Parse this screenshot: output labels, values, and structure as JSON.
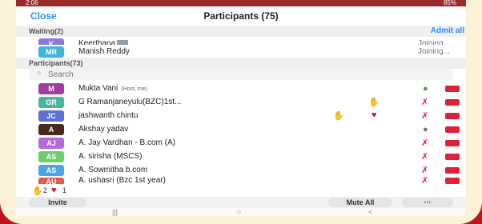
{
  "status_bar": {
    "time": "2:06",
    "battery": "85%"
  },
  "header": {
    "close_label": "Close",
    "title": "Participants (75)"
  },
  "waiting": {
    "label": "Waiting(2)",
    "admit_all_label": "Admit all",
    "items": [
      {
        "initials": "K",
        "name": "Keerthana",
        "status": "Joining...",
        "color": "#8b7bd8"
      },
      {
        "initials": "MR",
        "name": "Manish Reddy",
        "status": "Joining...",
        "color": "#3fb6d8"
      }
    ]
  },
  "participants": {
    "label": "Participants(73)",
    "search_placeholder": "Search",
    "items": [
      {
        "initials": "M",
        "name": "Mukta Vani",
        "note": "(Host, me)",
        "color": "#a03ea0"
      },
      {
        "initials": "GR",
        "name": "G Ramanjaneyulu(BZC)1st...",
        "color": "#4ab5a0"
      },
      {
        "initials": "JC",
        "name": "jashwanth chintu",
        "color": "#5d6fd1"
      },
      {
        "initials": "A",
        "name": "Akshay yadav",
        "color": "#4a2a1c"
      },
      {
        "initials": "AJ",
        "name": "A. Jay Vardhan - B.com (A)",
        "color": "#b16ad6"
      },
      {
        "initials": "AS",
        "name": "A. sirisha (MSCS)",
        "color": "#6ccf6a"
      },
      {
        "initials": "AS",
        "name": "A. Sowmitha b.com",
        "color": "#4aa6e6"
      },
      {
        "initials": "AU",
        "name": "A. ushasri (Bzc 1st year)",
        "color": "#e65a4a"
      }
    ]
  },
  "reactions": {
    "raise_hand_count": "2",
    "heart_count": "1"
  },
  "footer": {
    "invite_label": "Invite",
    "mute_all_label": "Mute All",
    "more_label": "···"
  },
  "navbar": {
    "recent": "|||",
    "home": "○",
    "back": "<"
  },
  "colors": {
    "accent": "#2d8cff",
    "muted_red": "#e0203a",
    "frame_red": "#c0141c"
  }
}
